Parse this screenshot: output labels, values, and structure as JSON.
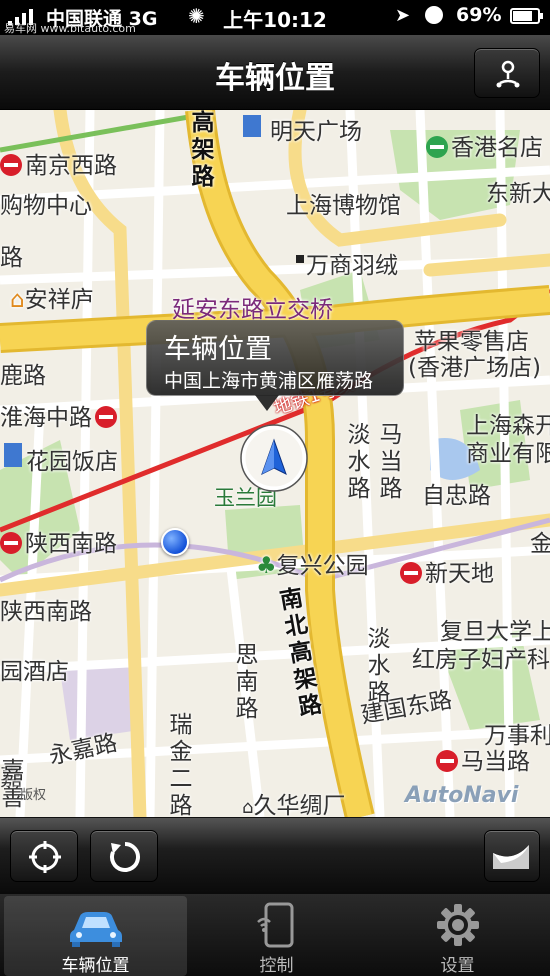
{
  "status_bar": {
    "carrier": "中国联通 3G",
    "time": "上午10:12",
    "battery": "69%",
    "watermark": "易车网 www.bitauto.com"
  },
  "nav": {
    "title": "车辆位置",
    "right_button_icon": "route-pin-icon"
  },
  "map": {
    "callout": {
      "title": "车辆位置",
      "address": "中国上海市黄浦区雁荡路"
    },
    "labels": {
      "mingtian": "明天广场",
      "hk_shop": "香港名店",
      "nanjingxilu": "南京西路",
      "dongxinda": "东新大",
      "gouwu": "购物中心",
      "shbwg": "上海博物馆",
      "wanshang": "万商羽绒",
      "lu1": "路",
      "anxiang": "安祥庐",
      "yanan": "延安东路立交桥",
      "apple1": "苹果零售店",
      "apple2": "(香港广场店)",
      "lu2": "鹿路",
      "huaihai": "淮海中路",
      "dtyhx": "地铁1号线",
      "senmao1": "上海森开",
      "senmao2": "商业有限",
      "huayuan": "花园饭店",
      "ziyou": "自忠路",
      "yulan": "玉兰园",
      "shanxi": "陕西南路",
      "jin": "金",
      "fuxing": "复兴公园",
      "xintiandi": "新天地",
      "shanxi2": "陕西南路",
      "fudan1": "复旦大学上",
      "fudan2": "红房子妇产科",
      "yuanjiu": "园酒店",
      "jianguo": "建国东路",
      "wanshi": "万事利",
      "yongjia": "永嘉路",
      "majia": "马当路",
      "jiuhua": "久华绸厂",
      "xiang": "嘉",
      "v_gaojia": "高架路",
      "v_danshui": "淡水路",
      "v_madang": "马当路",
      "v_nanbei": "南北高架路",
      "v_danshui2": "淡水路",
      "v_sinan": "思南路",
      "v_ruijin": "瑞金二路",
      "v_jia": "嘉善"
    },
    "copyright": "版权",
    "provider": "AutoNavi"
  },
  "toolbar": {
    "locate_icon": "crosshair-icon",
    "refresh_icon": "refresh-icon",
    "pagecurl_icon": "page-curl-icon"
  },
  "tabs": [
    {
      "label": "车辆位置",
      "icon": "car-icon",
      "active": true
    },
    {
      "label": "控制",
      "icon": "phone-control-icon",
      "active": false
    },
    {
      "label": "设置",
      "icon": "gear-icon",
      "active": false
    }
  ]
}
